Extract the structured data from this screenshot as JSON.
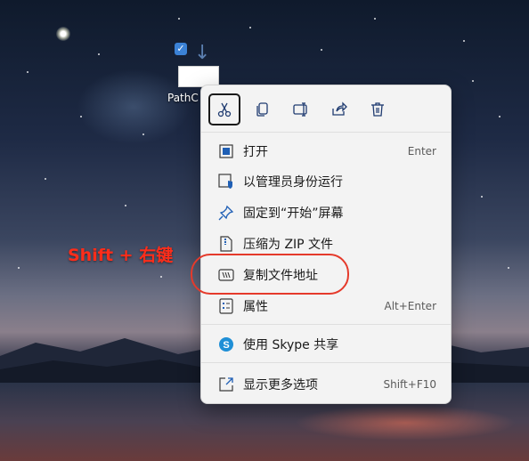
{
  "desktop": {
    "file_label": "PathC"
  },
  "annotation": {
    "text": "Shift + 右键"
  },
  "context_menu": {
    "toolbar": [
      {
        "name": "cut",
        "icon": "scissors-icon"
      },
      {
        "name": "copy",
        "icon": "copy-icon"
      },
      {
        "name": "rename",
        "icon": "rename-icon"
      },
      {
        "name": "share",
        "icon": "share-icon"
      },
      {
        "name": "delete",
        "icon": "trash-icon"
      }
    ],
    "items": [
      {
        "label": "打开",
        "shortcut": "Enter",
        "icon": "open-icon"
      },
      {
        "label": "以管理员身份运行",
        "shortcut": "",
        "icon": "admin-run-icon"
      },
      {
        "label": "固定到“开始”屏幕",
        "shortcut": "",
        "icon": "pin-icon"
      },
      {
        "label": "压缩为 ZIP 文件",
        "shortcut": "",
        "icon": "zip-icon"
      },
      {
        "label": "复制文件地址",
        "shortcut": "",
        "icon": "copy-path-icon"
      },
      {
        "label": "属性",
        "shortcut": "Alt+Enter",
        "icon": "properties-icon"
      },
      {
        "label": "使用 Skype 共享",
        "shortcut": "",
        "icon": "skype-icon"
      },
      {
        "label": "显示更多选项",
        "shortcut": "Shift+F10",
        "icon": "more-options-icon"
      }
    ]
  },
  "colors": {
    "annotation": "#ff2d1a",
    "accent": "#1f5fb5"
  }
}
